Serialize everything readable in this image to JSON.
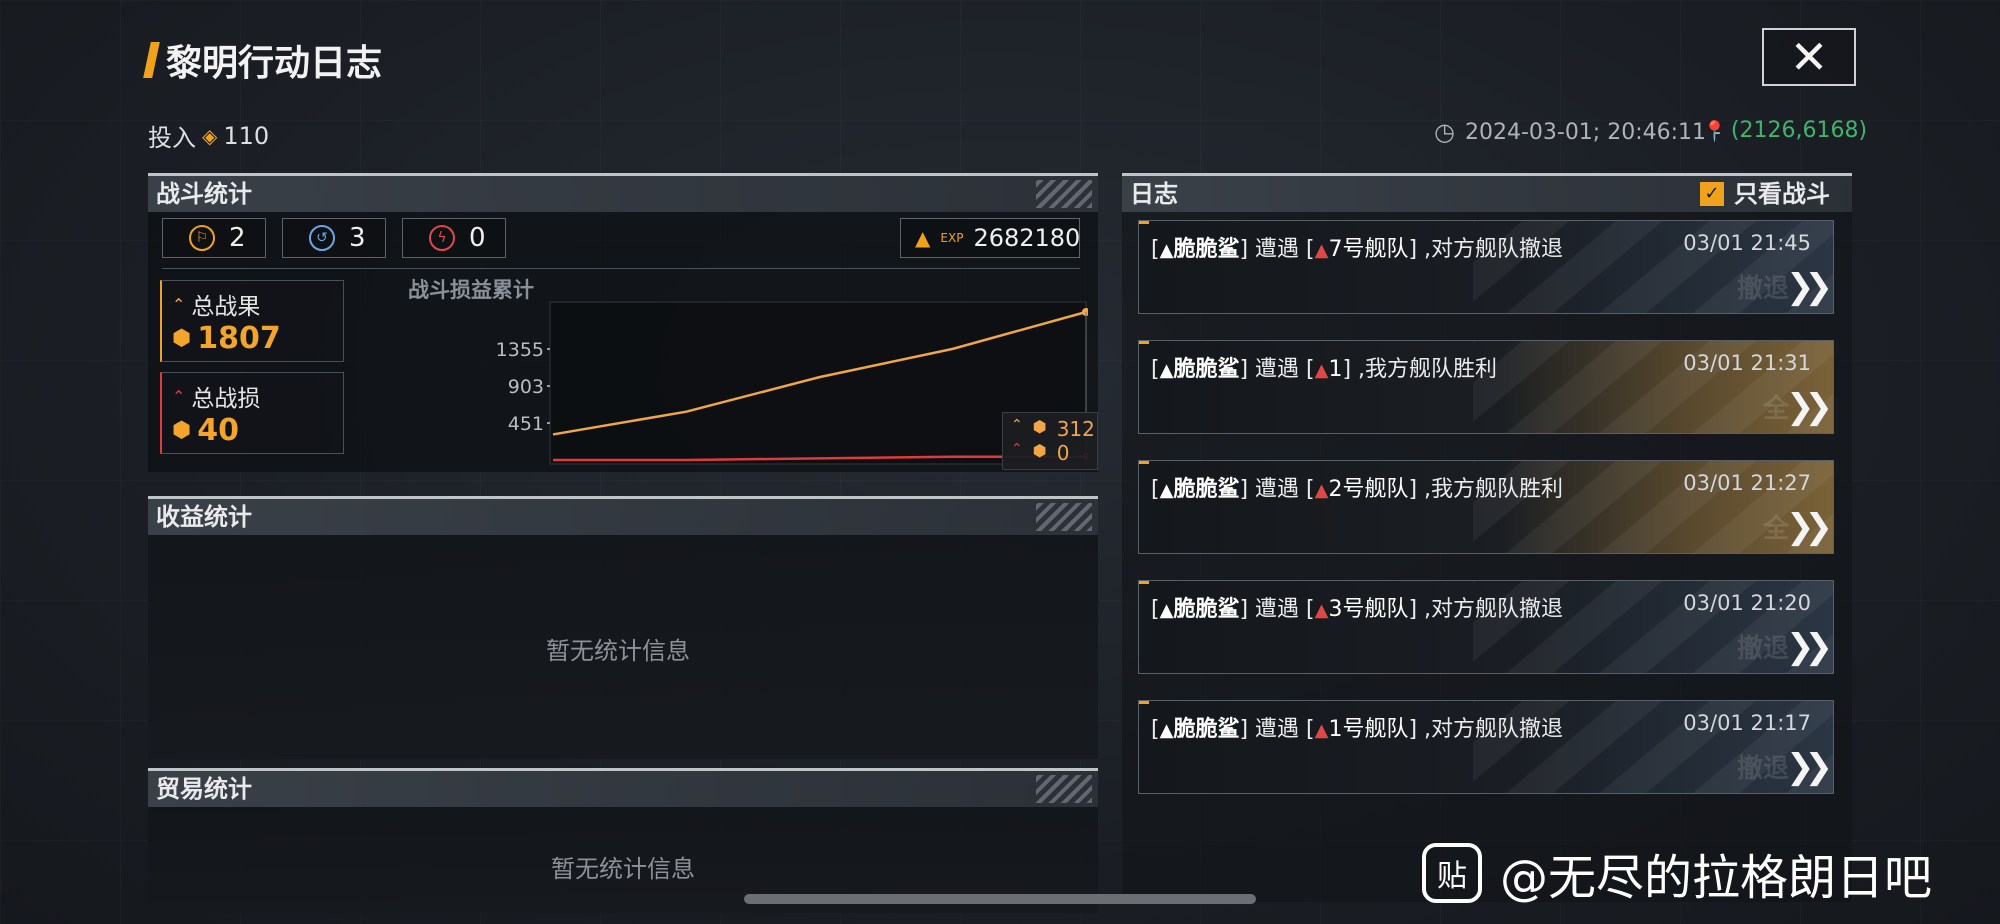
{
  "header": {
    "title": "黎明行动日志",
    "close_label": "✕"
  },
  "info": {
    "invest_label": "投入",
    "invest_value": "110",
    "datetime": "2024-03-01; 20:46:11 -",
    "coords": "(2126,6168)"
  },
  "battle": {
    "title": "战斗统计",
    "chips": [
      {
        "icon": "flag-icon",
        "value": "2",
        "color": "#f0a21c"
      },
      {
        "icon": "retreat-icon",
        "value": "3",
        "color": "#6aa6e6"
      },
      {
        "icon": "defeat-icon",
        "value": "0",
        "color": "#e04848"
      }
    ],
    "exp_label": "EXP",
    "exp_value": "2682180",
    "total_gain_label": "总战果",
    "total_gain_value": "1807",
    "total_loss_label": "总战损",
    "total_loss_value": "40"
  },
  "chart_data": {
    "type": "line",
    "title": "战斗损益累计",
    "yticks": [
      "1355",
      "903",
      "451"
    ],
    "ylim": [
      0,
      1807
    ],
    "x": [
      1,
      2,
      3,
      4,
      5
    ],
    "series": [
      {
        "values": [
          312,
          590,
          1012,
          1357,
          1807
        ],
        "color": "#f0a646"
      },
      {
        "values": [
          0,
          0,
          20,
          40,
          40
        ],
        "color": "#e03a3a"
      }
    ],
    "tooltip": {
      "gain": "312",
      "loss": "0"
    }
  },
  "income": {
    "title": "收益统计",
    "empty": "暂无统计信息"
  },
  "trade": {
    "title": "贸易统计",
    "empty": "暂无统计信息"
  },
  "log": {
    "title": "日志",
    "filter_label": "只看战斗",
    "filter_checked": true,
    "entries": [
      {
        "friend": "脆脆鲨",
        "verb": "遭遇",
        "enemy": "7号舰队",
        "result": ",对方舰队撤退",
        "time": "03/01 21:45",
        "ghost": "撤退"
      },
      {
        "friend": "脆脆鲨",
        "verb": "遭遇",
        "enemy": "1",
        "result": ",我方舰队胜利",
        "time": "03/01 21:31",
        "ghost": "全"
      },
      {
        "friend": "脆脆鲨",
        "verb": "遭遇",
        "enemy": "2号舰队",
        "result": ",我方舰队胜利",
        "time": "03/01 21:27",
        "ghost": "全"
      },
      {
        "friend": "脆脆鲨",
        "verb": "遭遇",
        "enemy": "3号舰队",
        "result": ",对方舰队撤退",
        "time": "03/01 21:20",
        "ghost": "撤退"
      },
      {
        "friend": "脆脆鲨",
        "verb": "遭遇",
        "enemy": "1号舰队",
        "result": ",对方舰队撤退",
        "time": "03/01 21:17",
        "ghost": "撤退"
      }
    ]
  },
  "watermark": {
    "icon_text": "贴",
    "text": "@无尽的拉格朗日吧"
  }
}
